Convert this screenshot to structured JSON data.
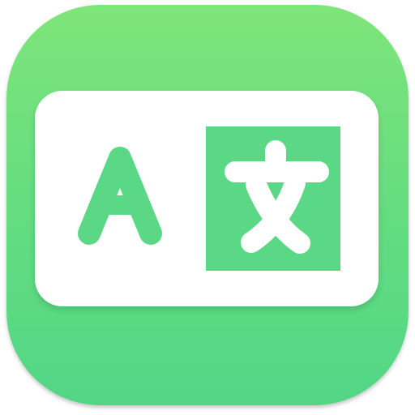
{
  "app_icon": {
    "name": "translate-app-icon",
    "colors": {
      "tile_top": "#7ee57a",
      "tile_bottom": "#52d686",
      "panel_green": "#5ad886",
      "card": "#ffffff"
    },
    "latin_glyph": "A",
    "cjk_glyph": "文"
  }
}
